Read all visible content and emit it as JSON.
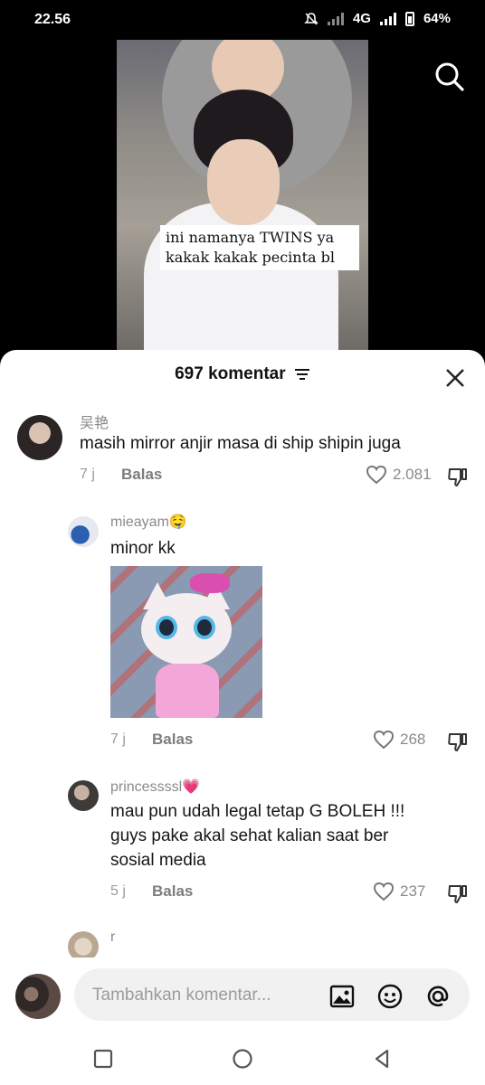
{
  "status": {
    "time": "22.56",
    "network": "4G",
    "battery": "64%"
  },
  "video": {
    "caption_line1": "ini namanya TWINS ya",
    "caption_line2": "kakak kakak pecinta bl"
  },
  "sheet": {
    "title": "697 komentar"
  },
  "comments": [
    {
      "username": "吴艳",
      "text": "masih mirror anjir masa di ship shipin juga",
      "time": "7 j",
      "reply_label": "Balas",
      "likes": "2.081"
    },
    {
      "username": "mieayam🤤",
      "text": "minor kk",
      "time": "7 j",
      "reply_label": "Balas",
      "likes": "268"
    },
    {
      "username": "princessssl💗",
      "text_lines": [
        "mau pun udah legal tetap G BOLEH !!!",
        "guys pake akal sehat kalian saat ber",
        "sosial media"
      ],
      "time": "5 j",
      "reply_label": "Balas",
      "likes": "237"
    },
    {
      "username": "r"
    }
  ],
  "input": {
    "placeholder": "Tambahkan komentar..."
  },
  "icons": {
    "search": "search-icon",
    "close": "close-icon",
    "filter": "filter-icon",
    "heart": "heart-icon",
    "dislike": "thumbs-down-icon",
    "image": "image-icon",
    "emoji": "emoji-icon",
    "mention": "at-icon"
  }
}
